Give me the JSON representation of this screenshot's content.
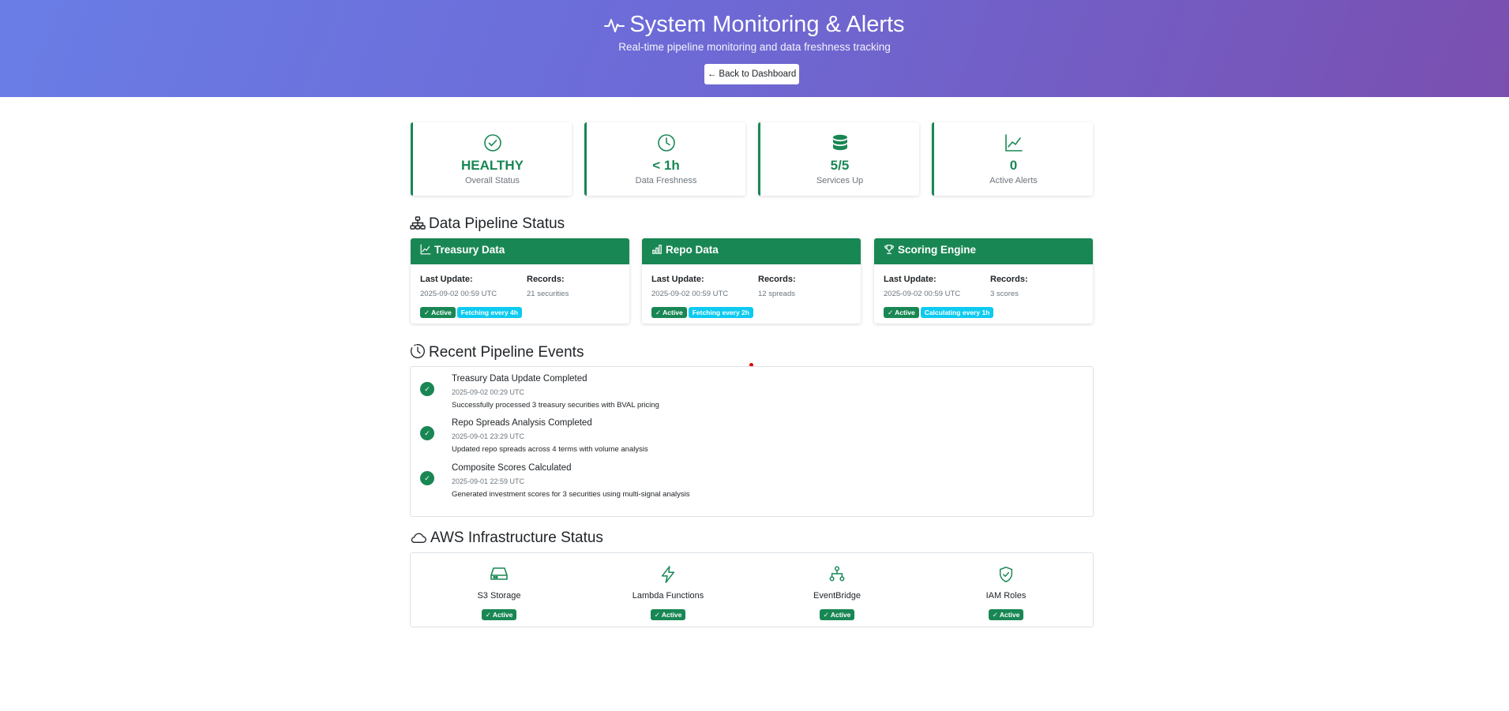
{
  "header": {
    "title": "System Monitoring & Alerts",
    "title_icon": "activity-icon",
    "subtitle": "Real-time pipeline monitoring and data freshness tracking",
    "back_button": "← Back to Dashboard",
    "gradient_colors": [
      "#667eea",
      "#764ba2"
    ]
  },
  "stats": [
    {
      "icon": "check-circle-icon",
      "value": "HEALTHY",
      "label": "Overall Status"
    },
    {
      "icon": "clock-icon",
      "value": "< 1h",
      "label": "Data Freshness"
    },
    {
      "icon": "database-icon",
      "value": "5/5",
      "label": "Services Up"
    },
    {
      "icon": "graph-up-icon",
      "value": "0",
      "label": "Active Alerts"
    }
  ],
  "pipeline": {
    "title": "Data Pipeline Status",
    "title_icon": "diagram-icon",
    "cards": [
      {
        "icon": "graph-up-icon",
        "name": "Treasury Data",
        "last_update_label": "Last Update:",
        "last_update": "2025-09-02 00:59 UTC",
        "records_label": "Records:",
        "records": "21 securities",
        "status": "✓ Active",
        "schedule": "Fetching every 4h"
      },
      {
        "icon": "bar-chart-icon",
        "name": "Repo Data",
        "last_update_label": "Last Update:",
        "last_update": "2025-09-02 00:59 UTC",
        "records_label": "Records:",
        "records": "12 spreads",
        "status": "✓ Active",
        "schedule": "Fetching every 2h"
      },
      {
        "icon": "trophy-icon",
        "name": "Scoring Engine",
        "last_update_label": "Last Update:",
        "last_update": "2025-09-02 00:59 UTC",
        "records_label": "Records:",
        "records": "3 scores",
        "status": "✓ Active",
        "schedule": "Calculating every 1h"
      }
    ]
  },
  "events": {
    "title": "Recent Pipeline Events",
    "title_icon": "history-icon",
    "items": [
      {
        "title": "Treasury Data Update Completed",
        "time": "2025-09-02 00:29 UTC",
        "desc": "Successfully processed 3 treasury securities with BVAL pricing"
      },
      {
        "title": "Repo Spreads Analysis Completed",
        "time": "2025-09-01 23:29 UTC",
        "desc": "Updated repo spreads across 4 terms with volume analysis"
      },
      {
        "title": "Composite Scores Calculated",
        "time": "2025-09-01 22:59 UTC",
        "desc": "Generated investment scores for 3 securities using multi-signal analysis"
      }
    ]
  },
  "infra": {
    "title": "AWS Infrastructure Status",
    "title_icon": "cloud-icon",
    "items": [
      {
        "icon": "hdd-icon",
        "name": "S3 Storage",
        "status": "✓ Active"
      },
      {
        "icon": "lightning-icon",
        "name": "Lambda Functions",
        "status": "✓ Active"
      },
      {
        "icon": "diagram-icon",
        "name": "EventBridge",
        "status": "✓ Active"
      },
      {
        "icon": "shield-check-icon",
        "name": "IAM Roles",
        "status": "✓ Active"
      }
    ]
  },
  "colors": {
    "success": "#198754",
    "info": "#0dcaf0",
    "muted": "#6c757d"
  }
}
